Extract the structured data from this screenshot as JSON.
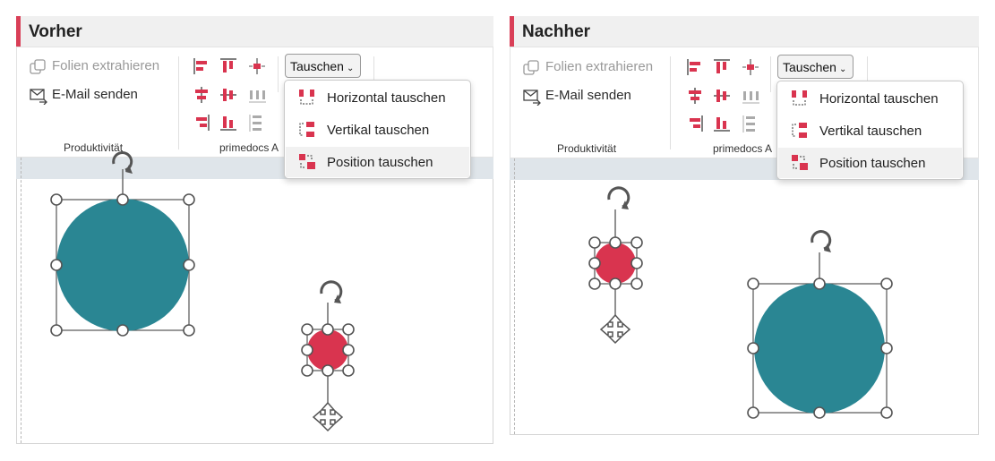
{
  "colors": {
    "accent": "#d93f57",
    "teal": "#2a8693",
    "red": "#d9344f",
    "canvas_bg": "#ffffff"
  },
  "panels": [
    {
      "title": "Vorher",
      "ribbon": {
        "extract_label": "Folien extrahieren",
        "email_label": "E-Mail senden",
        "group_productivity": "Produktivität",
        "group_primedocs": "primedocs A",
        "dropdown_label": "Tauschen",
        "menu": [
          "Horizontal tauschen",
          "Vertikal tauschen",
          "Position tauschen"
        ],
        "highlighted_item": "Position tauschen"
      },
      "shapes": [
        "large teal circle selected",
        "small red circle selected"
      ]
    },
    {
      "title": "Nachher",
      "ribbon": {
        "extract_label": "Folien extrahieren",
        "email_label": "E-Mail senden",
        "group_productivity": "Produktivität",
        "group_primedocs": "primedocs A",
        "dropdown_label": "Tauschen",
        "menu": [
          "Horizontal tauschen",
          "Vertikal tauschen",
          "Position tauschen"
        ],
        "highlighted_item": "Position tauschen"
      }
    }
  ],
  "icons": [
    "copy-slides-icon",
    "email-send-icon",
    "align-left-icon",
    "align-top-icon",
    "align-center-icon",
    "distribute-horizontal-icon",
    "distribute-vertical-icon",
    "rotate-handle-icon",
    "move-handle-icon"
  ]
}
